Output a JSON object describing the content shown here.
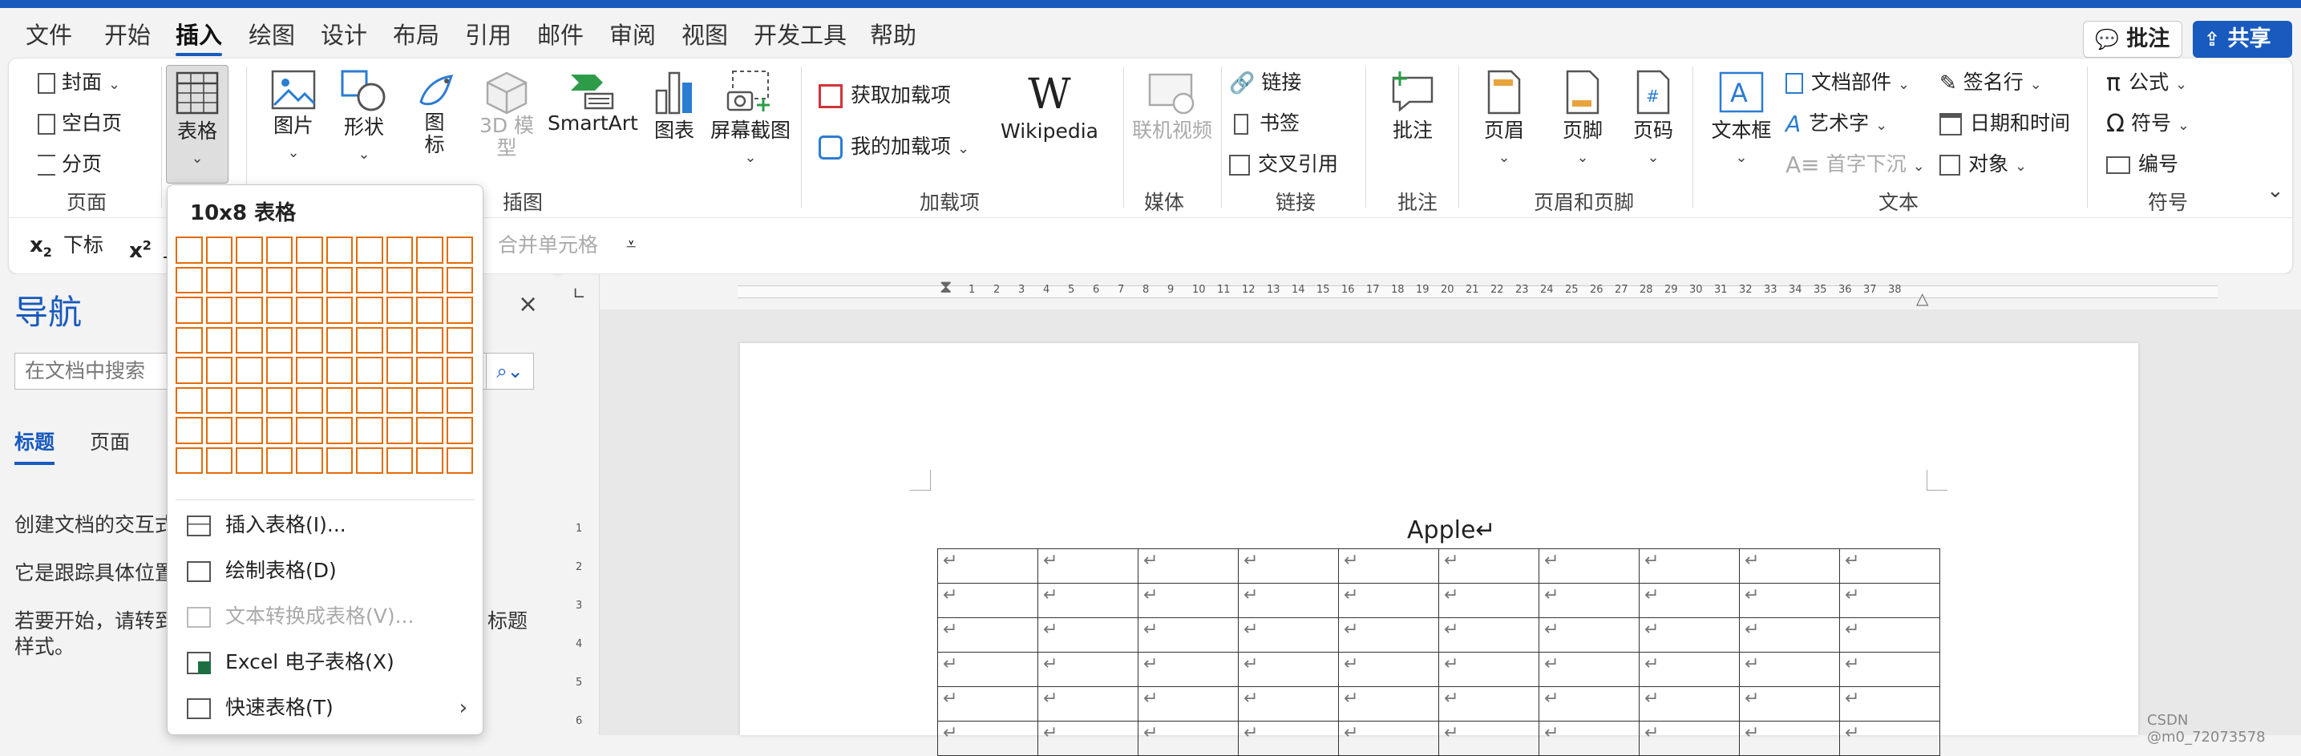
{
  "menubar": {
    "tabs": [
      {
        "label": "文件"
      },
      {
        "label": "开始"
      },
      {
        "label": "插入"
      },
      {
        "label": "绘图"
      },
      {
        "label": "设计"
      },
      {
        "label": "布局"
      },
      {
        "label": "引用"
      },
      {
        "label": "邮件"
      },
      {
        "label": "审阅"
      },
      {
        "label": "视图"
      },
      {
        "label": "开发工具"
      },
      {
        "label": "帮助"
      }
    ],
    "comment_label": "批注",
    "share_label": "共享"
  },
  "ribbon": {
    "pages": {
      "cover": "封面",
      "blank": "空白页",
      "break": "分页",
      "group": "页面"
    },
    "table": {
      "label": "表格"
    },
    "illustrations": {
      "picture": "图片",
      "shapes": "形状",
      "icons": "图标",
      "model3d": "3D 模型",
      "smartart": "SmartArt",
      "chart": "图表",
      "screenshot": "屏幕截图",
      "group": "插图"
    },
    "addins": {
      "get": "获取加载项",
      "mine": "我的加载项",
      "wikipedia": "Wikipedia",
      "wikipedia_glyph": "W",
      "group": "加载项"
    },
    "media": {
      "video": "联机视频",
      "group": "媒体"
    },
    "links": {
      "link": "链接",
      "bookmark": "书签",
      "crossref": "交叉引用",
      "group": "链接"
    },
    "comments": {
      "comment": "批注",
      "group": "批注"
    },
    "headerfooter": {
      "header": "页眉",
      "footer": "页脚",
      "pagenum": "页码",
      "group": "页眉和页脚"
    },
    "text": {
      "textbox": "文本框",
      "parts": "文档部件",
      "wordart": "艺术字",
      "dropcap": "首字下沉",
      "signature": "签名行",
      "datetime": "日期和时间",
      "object": "对象",
      "group": "文本"
    },
    "symbols": {
      "equation": "公式",
      "symbol": "符号",
      "number": "编号",
      "group": "符号"
    },
    "row2": {
      "subscript": "下标",
      "superscript_prefix": "上",
      "merge": "合并单元格"
    }
  },
  "nav": {
    "title": "导航",
    "search_placeholder": "在文档中搜索",
    "tab_headings": "标题",
    "tab_pages": "页面",
    "line1": "创建文档的交互式",
    "line2": "它是跟踪具体位置",
    "line3a": "若要开始，请转到",
    "line3b": "标题",
    "line3c": "样式。"
  },
  "dropdown": {
    "title": "10x8 表格",
    "cols": 10,
    "rows": 8,
    "items": [
      {
        "label": "插入表格(I)..."
      },
      {
        "label": "绘制表格(D)"
      },
      {
        "label": "文本转换成表格(V)..."
      },
      {
        "label": "Excel 电子表格(X)"
      },
      {
        "label": "快速表格(T)"
      }
    ]
  },
  "document": {
    "title": "Apple↵",
    "cell_mark": "↵",
    "cols": 10,
    "visible_rows": 6
  },
  "ruler_numbers": [
    "1",
    "2",
    "3",
    "4",
    "5",
    "6",
    "7",
    "8",
    "9",
    "10",
    "11",
    "12",
    "13",
    "14",
    "15",
    "16",
    "17",
    "18",
    "19",
    "20",
    "21",
    "22",
    "23",
    "24",
    "25",
    "26",
    "27",
    "28",
    "29",
    "30",
    "31",
    "32",
    "33",
    "34",
    "35",
    "36",
    "37",
    "38"
  ],
  "vruler_numbers": [
    "1",
    "2",
    "3",
    "4",
    "5",
    "6"
  ],
  "watermark": "CSDN @m0_72073578",
  "colors": {
    "accent": "#185abd",
    "grid_orange": "#e36c09"
  }
}
